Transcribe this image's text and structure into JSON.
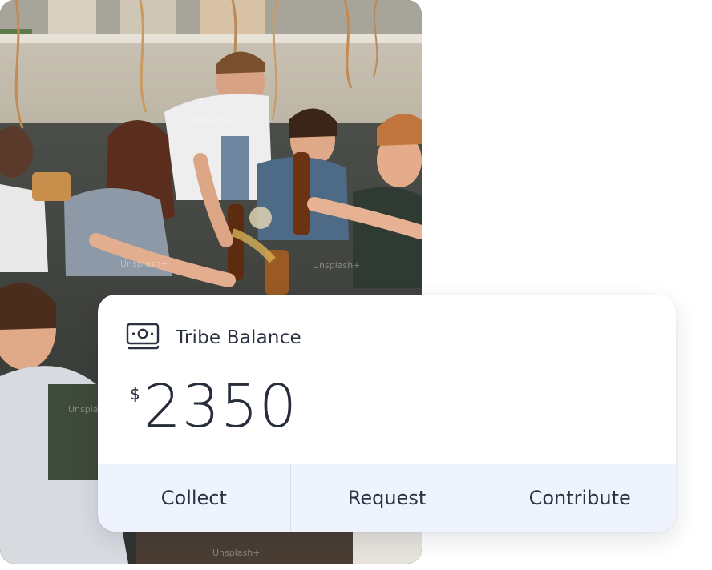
{
  "photo": {
    "alt": "Group of friends toasting with beer bottles on a rooftop",
    "watermark": "Unsplash+"
  },
  "balance_card": {
    "icon": "cash-icon",
    "title": "Tribe Balance",
    "currency_symbol": "$",
    "amount": "2350",
    "actions": [
      {
        "label": "Collect"
      },
      {
        "label": "Request"
      },
      {
        "label": "Contribute"
      }
    ]
  },
  "colors": {
    "text_primary": "#2b3140",
    "actions_background": "#eef3fd",
    "divider": "#d8dee9",
    "card_background": "#ffffff"
  }
}
